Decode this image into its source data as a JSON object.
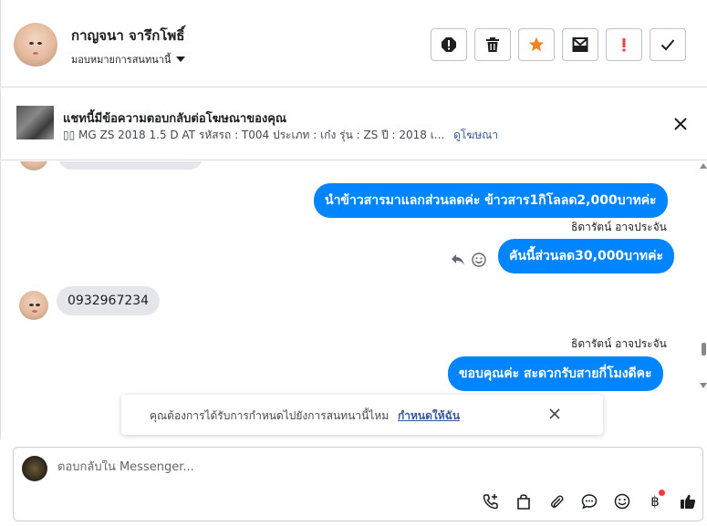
{
  "header": {
    "contact_name": "กาญจนา จารึกโพธิ์",
    "assign_label": "มอบหมายการสนทนานี้",
    "actions": [
      {
        "name": "spam-report-icon"
      },
      {
        "name": "trash-icon"
      },
      {
        "name": "star-icon"
      },
      {
        "name": "archive-icon"
      },
      {
        "name": "exclamation-icon"
      },
      {
        "name": "check-icon"
      }
    ]
  },
  "ad_banner": {
    "title": "แชทนี้มีข้อความตอบกลับต่อโฆษณาของคุณ",
    "details": "▯▯ MG ZS 2018 1.5 D AT รหัสรถ : T004 ประเภท : เก๋ง รุ่น : ZS ปี : 2018 เ...",
    "link": "ดูโฆษณา"
  },
  "messages": {
    "out1": "นำข้าวสารมาแลกส่วนลดค่ะ ข้าวสาร1กิโลลด2,000บาทค่ะ",
    "sender1": "ธิดารัตน์ อาจประจัน",
    "out2": "คันนี้ส่วนลด30,000บาทค่ะ",
    "in1": "0932967234",
    "sender2": "ธิดารัตน์ อาจประจัน",
    "out3": "ขอบคุณค่ะ สะดวกรับสายกี่โมงดีคะ"
  },
  "suggestion": {
    "text": "คุณต้องการได้รับการกำหนดไปยังการสนทนานี้ไหม",
    "link": "กำหนดให้ฉัน"
  },
  "composer": {
    "placeholder": "ตอบกลับใน Messenger..."
  },
  "colors": {
    "accent": "#0084ff",
    "star": "#f5821f",
    "danger": "#fa383e"
  }
}
